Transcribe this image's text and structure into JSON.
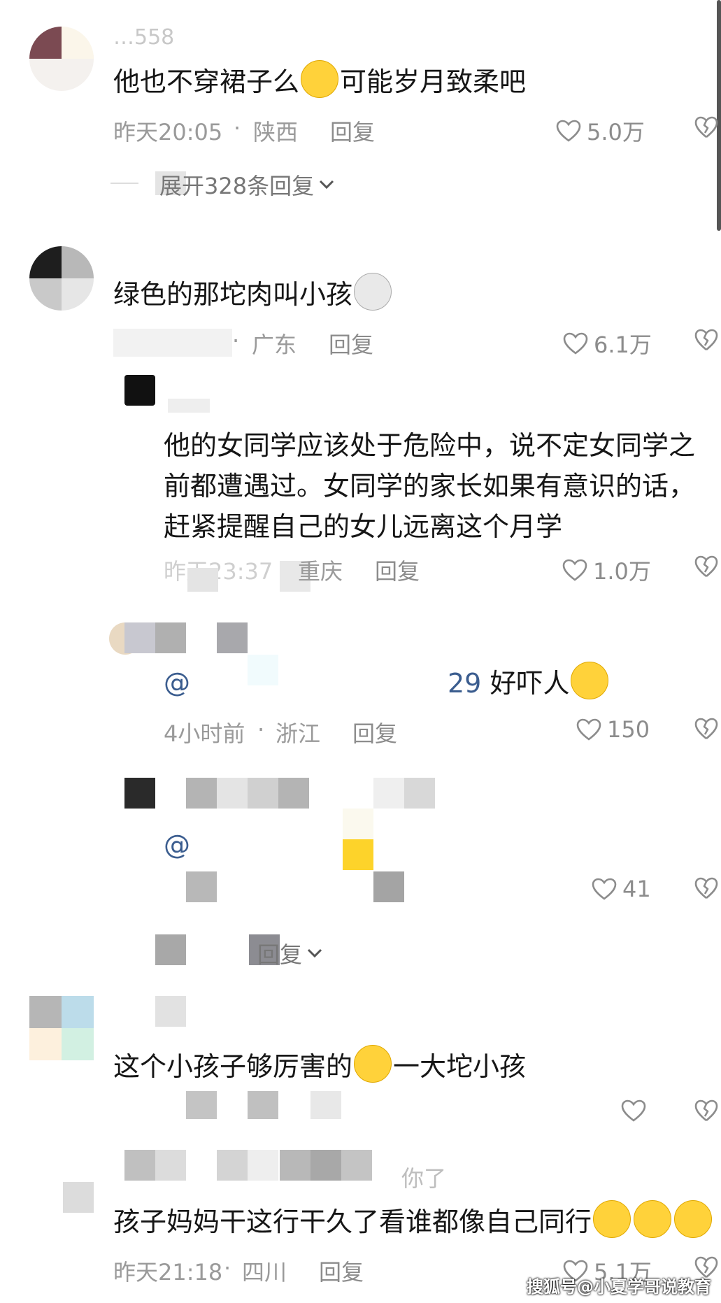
{
  "comments": [
    {
      "user": "…558",
      "text_before": "他也不穿裙子么",
      "text_after": "可能岁月致柔吧",
      "time": "昨天20:05",
      "location": "陕西",
      "reply_label": "回复",
      "likes": "5.0万",
      "expand_label": "展开328条回复"
    },
    {
      "text": "绿色的那坨肉叫小孩",
      "location": "广东",
      "reply_label": "回复",
      "likes": "6.1万",
      "replies": [
        {
          "lines": [
            "他的女同学应该处于危险中，说不定女同学之",
            "前都遭遇过。女同学的家长如果有意识的话，",
            "赶紧提醒自己的女儿远离这个月学"
          ],
          "time": "昨天23:37",
          "location": "重庆",
          "reply_label": "回复",
          "likes": "1.0万"
        },
        {
          "mention": "@",
          "mention_tail": "29",
          "text": "好吓人",
          "time": "4小时前",
          "location": "浙江",
          "reply_label": "回复",
          "likes": "150"
        },
        {
          "mention": "@",
          "likes": "41"
        }
      ],
      "expand_label": "回复"
    },
    {
      "text_before": "这个小孩子够厉害的",
      "text_after": "一大坨小孩",
      "likes": ""
    },
    {
      "user_fragment": "你了",
      "text": "孩子妈妈干这行干久了看谁都像自己同行",
      "time": "昨天21:18",
      "location": "四川",
      "reply_label": "回复",
      "likes": "5.1万"
    }
  ],
  "watermark": "搜狐号@小夏学哥说教育",
  "icons": {
    "like": "heart-outline-icon",
    "dislike": "broken-heart-icon",
    "expand": "chevron-down-icon"
  },
  "separator": "·"
}
